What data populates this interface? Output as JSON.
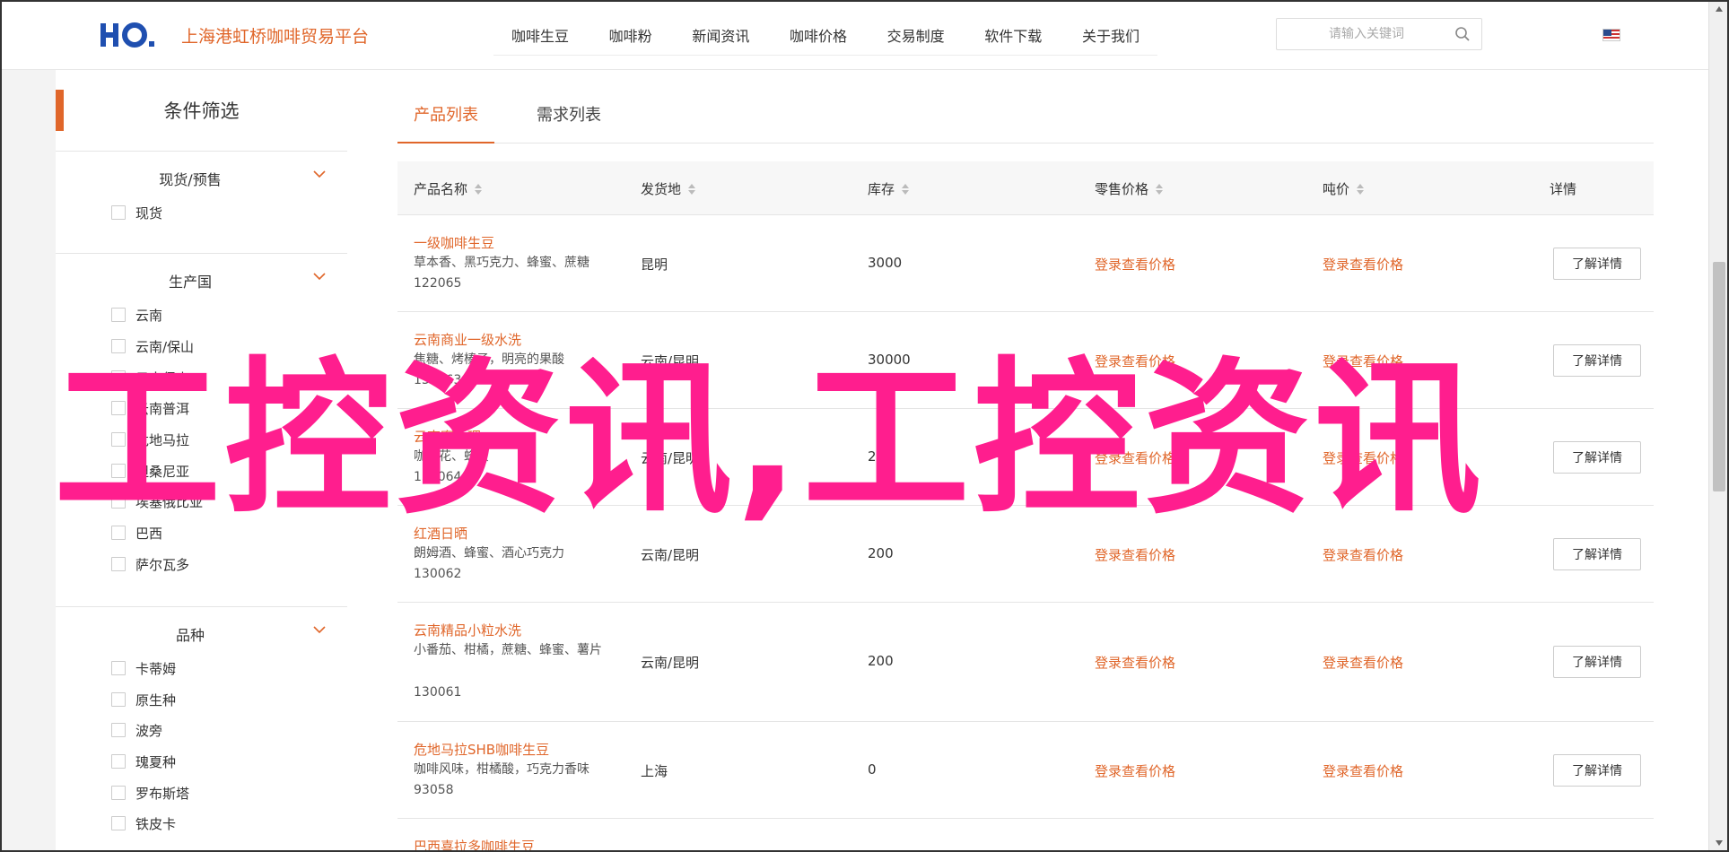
{
  "header": {
    "logo_text": "HO.",
    "site_title": "上海港虹桥咖啡贸易平台",
    "nav": [
      "咖啡生豆",
      "咖啡粉",
      "新闻资讯",
      "咖啡价格",
      "交易制度",
      "软件下载",
      "关于我们"
    ],
    "search_placeholder": "请输入关键词",
    "language_icon": "us-flag-icon",
    "accent_color": "#e0662a"
  },
  "sidebar": {
    "title": "条件筛选",
    "groups": [
      {
        "name": "现货/预售",
        "options": [
          "现货"
        ]
      },
      {
        "name": "生产国",
        "options": [
          "云南",
          "云南/保山",
          "云南保山",
          "云南普洱",
          "危地马拉",
          "坦桑尼亚",
          "埃塞俄比亚",
          "巴西",
          "萨尔瓦多"
        ]
      },
      {
        "name": "品种",
        "options": [
          "卡蒂姆",
          "原生种",
          "波旁",
          "瑰夏种",
          "罗布斯塔",
          "铁皮卡"
        ]
      }
    ]
  },
  "tabs": [
    "产品列表",
    "需求列表"
  ],
  "table": {
    "headers": [
      "产品名称",
      "发货地",
      "库存",
      "零售价格",
      "吨价",
      "详情"
    ],
    "rows": [
      {
        "name": "一级咖啡生豆",
        "desc": "草本香、黑巧克力、蜂蜜、蔗糖",
        "id": "122065",
        "origin": "昆明",
        "stock": "3000",
        "retail": "登录查看价格",
        "ton": "登录查看价格",
        "detail": "了解详情"
      },
      {
        "name": "云南商业一级水洗",
        "desc": "焦糖、烤榛子，明亮的果酸",
        "id": "130063",
        "origin": "云南/昆明",
        "stock": "30000",
        "retail": "登录查看价格",
        "ton": "登录查看价格",
        "detail": "了解详情"
      },
      {
        "name": "云南蜜处理",
        "desc": "咖啡花、蜂蜜",
        "id": "130064",
        "origin": "云南/昆明",
        "stock": "200",
        "retail": "登录查看价格",
        "ton": "登录查看价格",
        "detail": "了解详情"
      },
      {
        "name": "红酒日晒",
        "desc": "朗姆酒、蜂蜜、酒心巧克力",
        "id": "130062",
        "origin": "云南/昆明",
        "stock": "200",
        "retail": "登录查看价格",
        "ton": "登录查看价格",
        "detail": "了解详情"
      },
      {
        "name": "云南精品小粒水洗",
        "desc": "小番茄、柑橘，蔗糖、蜂蜜、薯片",
        "id": "130061",
        "origin": "云南/昆明",
        "stock": "200",
        "retail": "登录查看价格",
        "ton": "登录查看价格",
        "detail": "了解详情"
      },
      {
        "name": "危地马拉SHB咖啡生豆",
        "desc": "咖啡风味，柑橘酸，巧克力香味",
        "id": "93058",
        "origin": "上海",
        "stock": "0",
        "retail": "登录查看价格",
        "ton": "登录查看价格",
        "detail": "了解详情"
      },
      {
        "name": "巴西喜拉多咖啡生豆",
        "desc": "",
        "id": "",
        "origin": "",
        "stock": "",
        "retail": "",
        "ton": "",
        "detail": ""
      }
    ]
  },
  "watermark": "工控资讯,工控资讯"
}
